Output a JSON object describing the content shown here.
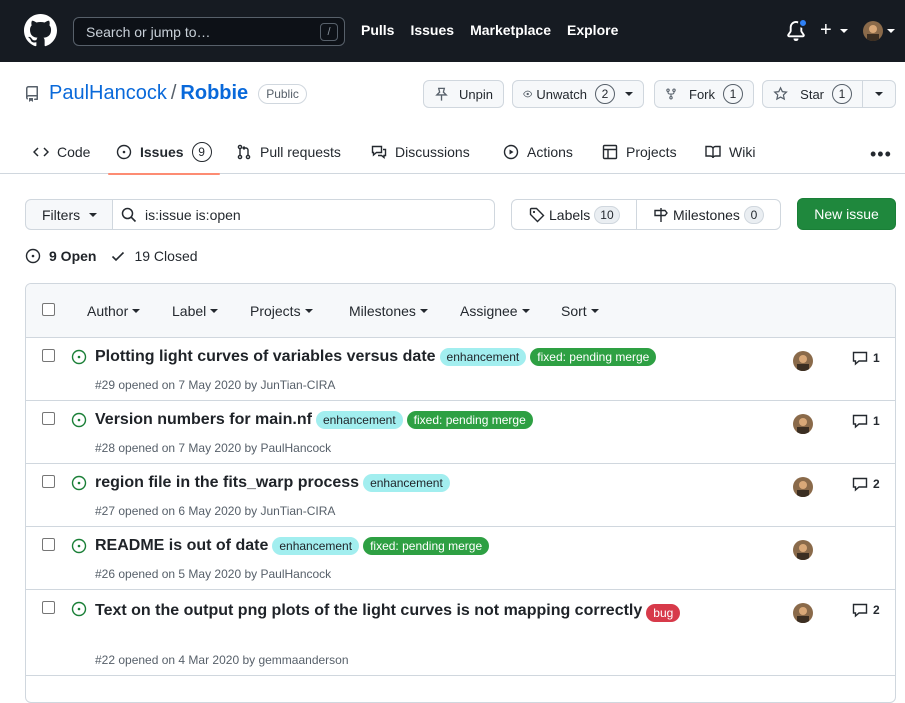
{
  "header": {
    "search_placeholder": "Search or jump to…",
    "search_shortcut": "/",
    "nav": [
      "Pulls",
      "Issues",
      "Marketplace",
      "Explore"
    ]
  },
  "repo": {
    "owner": "PaulHancock",
    "separator": "/",
    "name": "Robbie",
    "visibility": "Public",
    "unpin_label": "Unpin",
    "unwatch_label": "Unwatch",
    "unwatch_count": "2",
    "fork_label": "Fork",
    "fork_count": "1",
    "star_label": "Star",
    "star_count": "1"
  },
  "repo_nav": {
    "code": "Code",
    "issues": "Issues",
    "issues_count": "9",
    "pulls": "Pull requests",
    "discussions": "Discussions",
    "actions": "Actions",
    "projects": "Projects",
    "wiki": "Wiki"
  },
  "filters": {
    "filters_label": "Filters",
    "query": "is:issue is:open",
    "labels_label": "Labels",
    "labels_count": "10",
    "milestones_label": "Milestones",
    "milestones_count": "0",
    "new_issue": "New issue"
  },
  "state": {
    "open": "9 Open",
    "closed": "19 Closed"
  },
  "list_header": {
    "author": "Author",
    "label": "Label",
    "projects": "Projects",
    "milestones": "Milestones",
    "assignee": "Assignee",
    "sort": "Sort"
  },
  "issues": [
    {
      "title": "Plotting light curves of variables versus date",
      "labels": [
        "enhancement",
        "fixed: pending merge"
      ],
      "meta": "#29 opened on 7 May 2020 by JunTian-CIRA",
      "comments": "1"
    },
    {
      "title": "Version numbers for main.nf",
      "labels": [
        "enhancement",
        "fixed: pending merge"
      ],
      "meta": "#28 opened on 7 May 2020 by PaulHancock",
      "comments": "1"
    },
    {
      "title": "region file in the fits_warp process",
      "labels": [
        "enhancement"
      ],
      "meta": "#27 opened on 6 May 2020 by JunTian-CIRA",
      "comments": "2"
    },
    {
      "title": "README is out of date",
      "labels": [
        "enhancement",
        "fixed: pending merge"
      ],
      "meta": "#26 opened on 5 May 2020 by PaulHancock",
      "comments": ""
    },
    {
      "title": "Text on the output png plots of the light curves is not mapping correctly",
      "labels": [
        "bug"
      ],
      "meta": "#22 opened on 4 Mar 2020 by gemmaanderson",
      "comments": "2"
    }
  ],
  "label_colors": {
    "enhancement": {
      "bg": "#a2eeef",
      "fg": "#1f2328"
    },
    "fixed: pending merge": {
      "bg": "#2ea043",
      "fg": "#ffffff"
    },
    "bug": {
      "bg": "#d73a4a",
      "fg": "#ffffff"
    }
  },
  "colors": {
    "accent": "#0969da",
    "open_green": "#1a7f37",
    "primary_button": "#1f883d",
    "header_bg": "#161b22"
  }
}
